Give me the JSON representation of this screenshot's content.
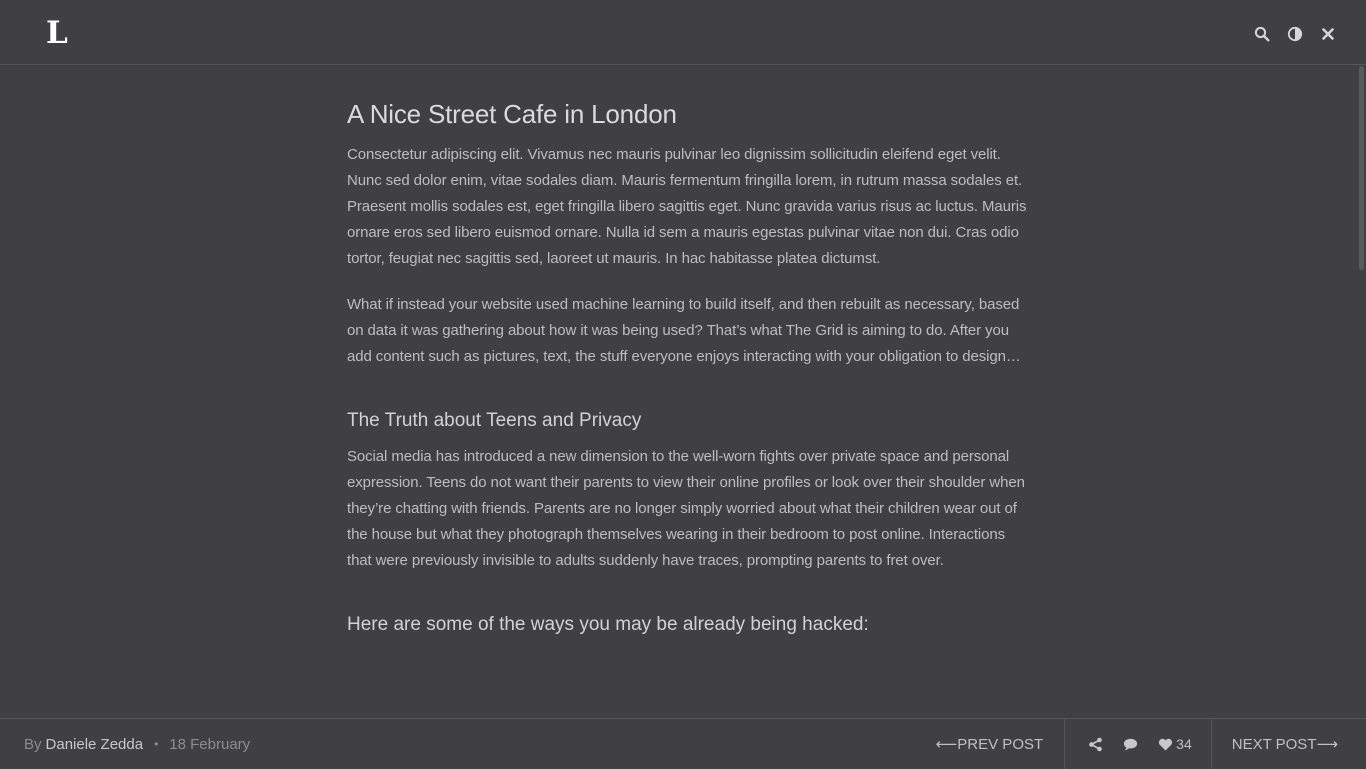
{
  "header": {
    "logo": "L",
    "icons": [
      "search-icon",
      "contrast-icon",
      "close-icon"
    ]
  },
  "article": {
    "title": "A Nice Street Cafe in London",
    "paragraphs": [
      "Consectetur adipiscing elit. Vivamus nec mauris pulvinar leo dignissim sollicitudin eleifend eget velit. Nunc sed dolor enim, vitae sodales diam. Mauris fermentum fringilla lorem, in rutrum massa sodales et. Praesent mollis sodales est, eget fringilla libero sagittis eget. Nunc gravida varius risus ac luctus. Mauris ornare eros sed libero euismod ornare. Nulla id sem a mauris egestas pulvinar vitae non dui. Cras odio tortor, feugiat nec sagittis sed, laoreet ut mauris. In hac habitasse platea dictumst.",
      "What if instead your website used machine learning to build itself, and then rebuilt as necessary, based on data it was gathering about how it was being used? That’s what The Grid is aiming to do. After you add content such as pictures, text, the stuff everyone enjoys interacting with your obligation to design…"
    ],
    "section1_title": "The Truth about Teens and Privacy",
    "section1_paragraph": "Social media has introduced a new dimension to the well-worn fights over private space and personal expression. Teens do not want their parents to view their online profiles or look over their shoulder when they’re chatting with friends. Parents are no longer simply worried about what their children wear out of the house but what they photograph themselves wearing in their bedroom to post online. Interactions that were previously invisible to adults suddenly have traces, prompting parents to fret over.",
    "section2_title": "Here are some of the ways you may be already being hacked:"
  },
  "footer": {
    "by_label": "By",
    "author": "Daniele Zedda",
    "separator": "•",
    "date": "18 February",
    "prev_arrow": "⟵",
    "prev_label": "PREV POST",
    "like_count": "34",
    "next_label": "NEXT POST",
    "next_arrow": "⟶",
    "icons": [
      "share-icon",
      "comment-icon",
      "heart-icon"
    ]
  },
  "colors": {
    "background": "#404042",
    "text": "#bdbdbf",
    "logo": "#ffffff",
    "divider": "#555557"
  }
}
